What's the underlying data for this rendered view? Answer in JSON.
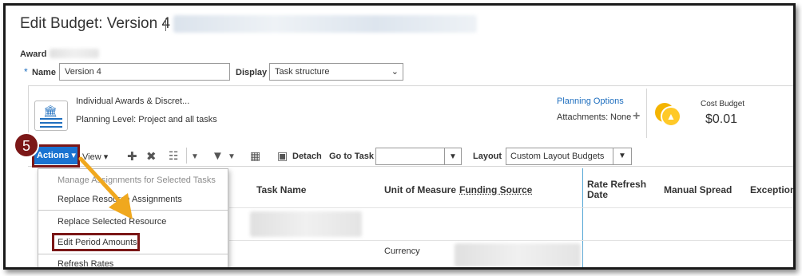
{
  "page": {
    "title": "Edit Budget: Version 4"
  },
  "award": {
    "label": "Award"
  },
  "form": {
    "required_mark": "*",
    "name_label": "Name",
    "name_value": "Version 4",
    "display_label": "Display",
    "display_value": "Task structure"
  },
  "summary": {
    "line1": "Individual Awards & Discret...",
    "line2": "Planning Level: Project and all tasks",
    "planning_options": "Planning Options",
    "attachments_label": "Attachments:",
    "attachments_value": "None",
    "cost_budget_label": "Cost Budget",
    "cost_budget_value": "$0.01"
  },
  "toolbar": {
    "step_badge": "5",
    "actions_label": "Actions ▾",
    "view_label": "View ▾",
    "detach_label": "Detach",
    "goto_label": "Go to Task",
    "layout_label": "Layout",
    "layout_value": "Custom Layout Budgets"
  },
  "table": {
    "headers": {
      "task_name": "Task Name",
      "unit_of_measure": "Unit of Measure",
      "funding_source": "Funding Source",
      "rate_refresh_date_1": "Rate Refresh",
      "rate_refresh_date_2": "Date",
      "manual_spread": "Manual Spread",
      "exceptions": "Exceptions"
    },
    "rows": [
      {
        "unit_of_measure": ""
      },
      {
        "unit_of_measure": "Currency"
      }
    ]
  },
  "actions_menu": {
    "items": [
      {
        "label": "Manage Assignments for Selected Tasks",
        "enabled": false
      },
      {
        "label": "Replace Resource Assignments",
        "enabled": true
      },
      {
        "label": "Replace Selected Resource",
        "enabled": true
      },
      {
        "label": "Edit Period Amounts",
        "enabled": true
      },
      {
        "label": "Refresh Rates",
        "enabled": true
      }
    ]
  },
  "colors": {
    "accent": "#1a73d1",
    "highlight": "#7b1717",
    "arrow": "#f0a81e",
    "link": "#1f6fbf"
  }
}
